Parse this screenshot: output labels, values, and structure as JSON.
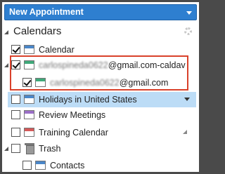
{
  "toolbar": {
    "new_appointment_label": "New Appointment"
  },
  "sidebar": {
    "section_title": "Calendars",
    "items": [
      {
        "label": "Calendar",
        "checked": true,
        "color": "#4a86c8"
      },
      {
        "label": "carlospineda0622@gmail.com-caldav",
        "label_prefix": "carlospineda0622",
        "label_suffix": "@gmail.com-caldav",
        "checked": true,
        "color": "#3fa97a"
      },
      {
        "label": "carlospineda0622@gmail.com",
        "label_prefix": "carlospineda0622",
        "label_suffix": "@gmail.com",
        "checked": true,
        "color": "#3fa97a"
      },
      {
        "label": "Holidays in United States",
        "checked": false,
        "color": "#4a86c8"
      },
      {
        "label": "Review Meetings",
        "checked": false,
        "color": "#9b6fc7"
      },
      {
        "label": "Training Calendar",
        "checked": false,
        "color": "#d45858"
      },
      {
        "label": "Trash",
        "checked": false
      },
      {
        "label": "Contacts",
        "checked": false,
        "color": "#4a86c8"
      }
    ]
  }
}
